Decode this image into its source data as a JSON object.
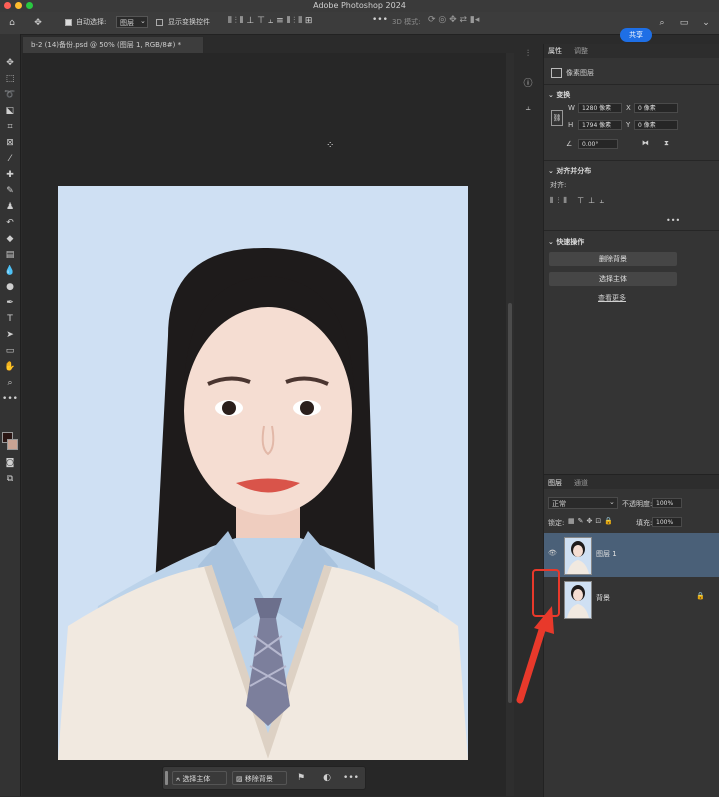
{
  "app": {
    "title": "Adobe Photoshop 2024"
  },
  "options_bar": {
    "auto_select_label": "自动选择:",
    "auto_select_value": "图层",
    "show_transform_label": "显示变换控件",
    "mode_3d_label": "3D 模式:",
    "share_label": "共享"
  },
  "document": {
    "tab_title": "b-2 (14)备份.psd @ 50% (图层 1, RGB/8#) *"
  },
  "panel_tabs": {
    "properties": "属性",
    "adjustments": "调整"
  },
  "properties": {
    "type_label": "像素图层",
    "transform": {
      "title": "变换",
      "w_label": "W",
      "w_value": "1280 像素",
      "x_label": "X",
      "x_value": "0 像素",
      "h_label": "H",
      "h_value": "1794 像素",
      "y_label": "Y",
      "y_value": "0 像素",
      "angle_value": "0.00°"
    },
    "align": {
      "title": "对齐并分布",
      "subtitle": "对齐:"
    },
    "quick_actions": {
      "title": "快速操作",
      "remove_bg": "删除背景",
      "select_subject": "选择主体",
      "learn_more": "查看更多"
    }
  },
  "layers_panel": {
    "tab_layers": "图层",
    "tab_channels": "通道",
    "blend_mode": "正常",
    "opacity_label": "不透明度:",
    "opacity_value": "100%",
    "lock_label": "锁定:",
    "fill_label": "填充:",
    "fill_value": "100%",
    "layers": [
      {
        "name": "图层 1",
        "visible": true,
        "selected": true,
        "locked": false
      },
      {
        "name": "背景",
        "visible": false,
        "selected": false,
        "locked": true
      }
    ]
  },
  "context_bar": {
    "select_subject": "选择主体",
    "remove_bg": "移除背景"
  },
  "colors": {
    "accent": "#1e6fe6",
    "selected_layer": "#4a6078",
    "annotation": "#e8392b",
    "photo_bg": "#cfe0f3"
  }
}
